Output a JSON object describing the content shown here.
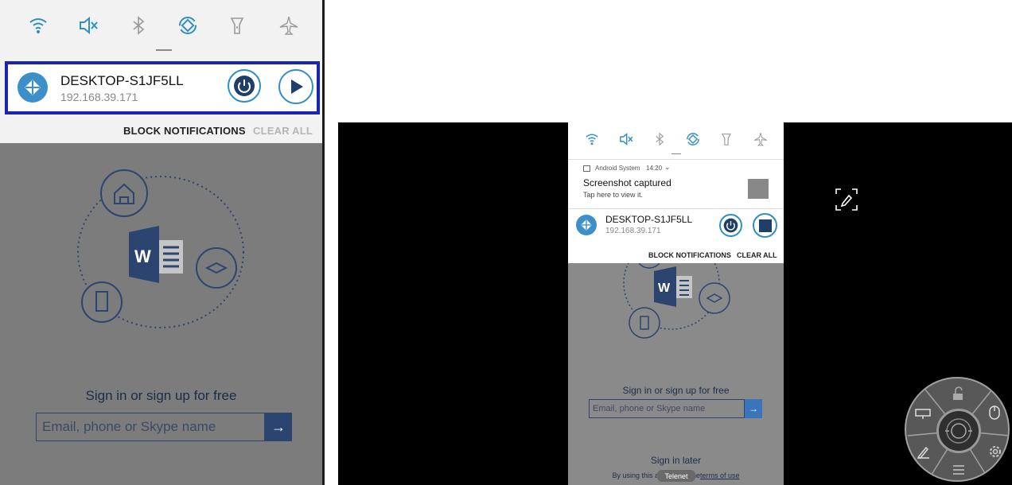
{
  "colors": {
    "accent_blue": "#2e8ec6",
    "highlight_border": "#1a24b4",
    "shade_bg": "#f2f2f2",
    "overlay_grey": "#7c7c7c",
    "background_black": "#000000",
    "disabled_text": "#b5b5b5"
  },
  "quick_settings": {
    "icons": [
      "wifi-icon",
      "mute-icon",
      "bluetooth-icon",
      "auto-rotate-icon",
      "flashlight-icon",
      "airplane-mode-icon"
    ]
  },
  "left_panel": {
    "notification": {
      "device_name": "DESKTOP-S1JF5LL",
      "ip": "192.168.39.171",
      "icons": [
        "power-icon",
        "play-icon"
      ]
    },
    "actions": {
      "block": "BLOCK NOTIFICATIONS",
      "clear": "CLEAR ALL"
    },
    "app": {
      "sign_in_text": "Sign in or sign up for free",
      "email_placeholder": "Email, phone or Skype name"
    }
  },
  "right_device": {
    "screenshot_notification": {
      "source": "Android System",
      "time": "14:20",
      "title": "Screenshot captured",
      "subtitle": "Tap here to view it."
    },
    "notification": {
      "device_name": "DESKTOP-S1JF5LL",
      "ip": "192.168.39.171",
      "icons": [
        "power-icon",
        "stop-icon"
      ]
    },
    "actions": {
      "block": "BLOCK NOTIFICATIONS",
      "clear": "CLEAR ALL"
    },
    "app": {
      "sign_in_text": "Sign in or sign up for free",
      "email_placeholder": "Email, phone or Skype name",
      "sign_in_later": "Sign in later",
      "terms_before": "By using this app, you",
      "terms_link": "terms of use",
      "terms_middle": " to the "
    },
    "toast": "Telenet"
  },
  "floating_controls": {
    "pen_tool": "pen-icon",
    "fab_segments": [
      "unlock-icon",
      "mouse-icon",
      "settings-icon",
      "list-icon",
      "pencil-icon",
      "display-icon",
      "joystick-icon"
    ]
  }
}
